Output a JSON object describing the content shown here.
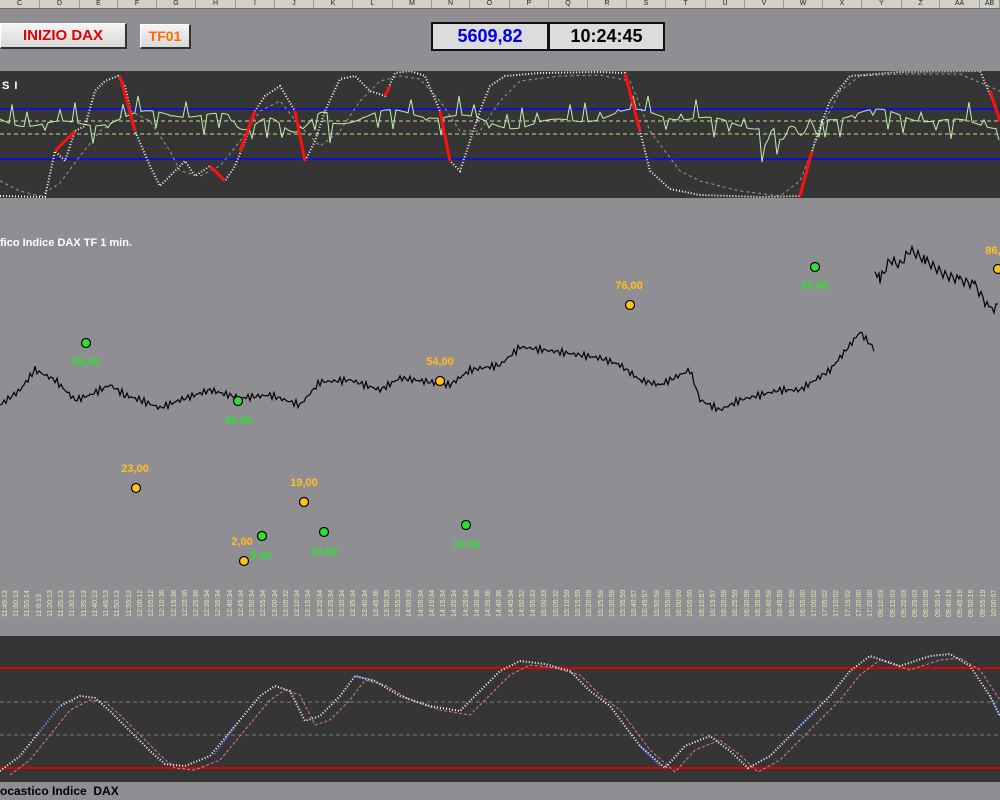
{
  "columns": [
    "C",
    "D",
    "E",
    "F",
    "G",
    "H",
    "I",
    "J",
    "K",
    "L",
    "M",
    "N",
    "O",
    "P",
    "Q",
    "R",
    "S",
    "T",
    "U",
    "V",
    "W",
    "X",
    "Y",
    "Z",
    "AA",
    "AB"
  ],
  "buttons": {
    "inizio": "INIZIO DAX",
    "tf": "TF01"
  },
  "readouts": {
    "price": "5609,82",
    "time": "10:24:45"
  },
  "rsi_panel": {
    "label": "S I"
  },
  "main_chart": {
    "title": "fico Indice DAX TF 1 min.",
    "points": [
      {
        "label": "65,00",
        "kind": "green"
      },
      {
        "label": "23,00",
        "kind": "orange"
      },
      {
        "label": "48,00",
        "kind": "green"
      },
      {
        "label": "2,00",
        "kind": "orange"
      },
      {
        "label": "9,00",
        "kind": "green"
      },
      {
        "label": "19,00",
        "kind": "orange"
      },
      {
        "label": "10,00",
        "kind": "green"
      },
      {
        "label": "54,00",
        "kind": "orange"
      },
      {
        "label": "12,00",
        "kind": "green"
      },
      {
        "label": "76,00",
        "kind": "orange"
      },
      {
        "label": "87,00",
        "kind": "green"
      },
      {
        "label": "86,",
        "kind": "orange"
      }
    ],
    "time_ticks": [
      "11:45:13",
      "11:50:13",
      "11:55:14",
      "11:6:13",
      "11:20:13",
      "11:25:13",
      "11:30:13",
      "11:35:13",
      "11:40:13",
      "11:45:13",
      "11:50:13",
      "11:55:13",
      "12:00:12",
      "12:05:12",
      "12:10:36",
      "12:15:36",
      "12:20:36",
      "12:25:36",
      "12:30:34",
      "12:35:34",
      "12:40:34",
      "12:45:34",
      "12:50:34",
      "12:55:34",
      "13:00:34",
      "13:05:32",
      "13:10:34",
      "13:15:34",
      "13:20:34",
      "13:25:34",
      "13:30:34",
      "13:35:34",
      "13:40:34",
      "13:45:36",
      "13:50:35",
      "13:55:33",
      "14:00:33",
      "14:05:34",
      "14:10:34",
      "14:15:34",
      "14:20:34",
      "14:25:34",
      "14:30:36",
      "14:35:36",
      "14:40:36",
      "14:45:34",
      "14:50:32",
      "14:55:33",
      "15:00:33",
      "15:05:32",
      "15:10:59",
      "15:15:59",
      "15:20:59",
      "15:25:59",
      "15:30:59",
      "15:35:59",
      "15:40:57",
      "15:45:57",
      "15:50:59",
      "15:55:00",
      "16:00:00",
      "16:05:00",
      "16:10:57",
      "16:15:57",
      "16:20:59",
      "16:25:59",
      "16:30:59",
      "16:35:59",
      "16:40:59",
      "16:45:59",
      "16:50:59",
      "16:55:00",
      "17:00:02",
      "17:05:02",
      "17:10:02",
      "17:15:02",
      "17:20:00",
      "17:25:00",
      "09:10:03",
      "09:15:03",
      "09:20:03",
      "09:25:03",
      "09:30:05",
      "09:35:14",
      "09:40:19",
      "09:45:19",
      "09:50:19",
      "09:55:19",
      "10:00:07"
    ]
  },
  "stoch_panel": {
    "title": "ocastico Indice  DAX"
  },
  "colors": {
    "bg_gray": "#8f8e93",
    "panel_dark": "#353535",
    "price_blue": "#0000e0",
    "inizio_red": "#e00000",
    "tf_orange": "#ff6a00",
    "label_orange": "#ffc020",
    "label_green": "#30e030",
    "rsi_line": "#c0f0b0",
    "rsi_band": "#1010d0",
    "stoch_band": "#e00000",
    "tick_yellow": "#e8e8b0"
  },
  "icons": {
    "orange_marker": "orange-dot-icon",
    "green_marker": "green-dot-icon"
  }
}
